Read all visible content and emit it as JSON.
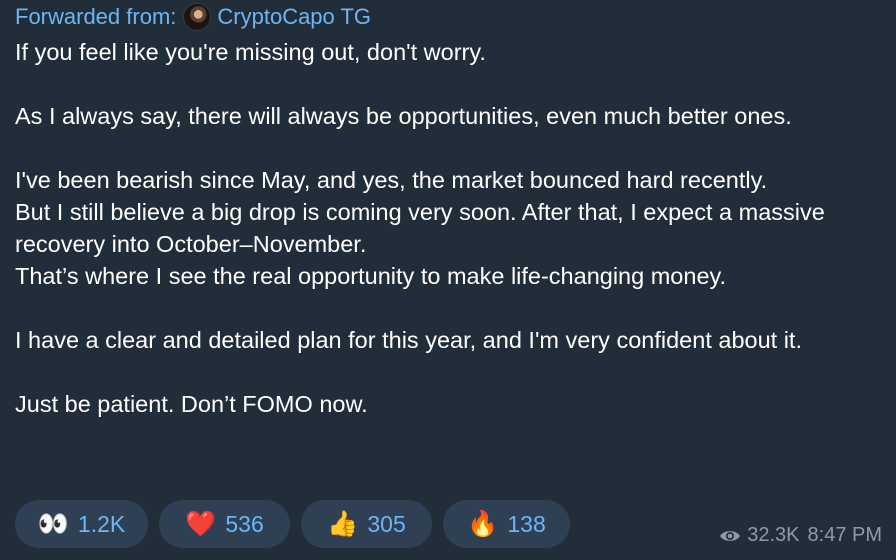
{
  "forward": {
    "prefix": "Forwarded from:",
    "channel": "CryptoCapo TG",
    "avatar_icon": "channel-avatar"
  },
  "message": {
    "paragraphs": [
      "If you feel like you're missing out, don't worry.",
      "As I always say, there will always be opportunities, even much better ones.",
      "I've been bearish since May, and yes, the market bounced hard recently.",
      "But I still believe a big drop is coming very soon. After that, I expect a massive recovery into October–November.",
      "That’s where I see the real opportunity to make life-changing money.",
      "I have a clear and detailed plan for this year, and I'm very confident about it.",
      "Just be patient. Don’t FOMO now."
    ]
  },
  "reactions": [
    {
      "emoji": "👀",
      "icon": "eyes-emoji",
      "count": "1.2K"
    },
    {
      "emoji": "❤️",
      "icon": "heart-emoji",
      "count": "536"
    },
    {
      "emoji": "👍",
      "icon": "thumbs-up-emoji",
      "count": "305"
    },
    {
      "emoji": "🔥",
      "icon": "fire-emoji",
      "count": "138"
    }
  ],
  "meta": {
    "views": "32.3K",
    "time": "8:47 PM",
    "views_icon": "eye-icon"
  },
  "colors": {
    "background": "#222d3a",
    "link": "#6cb6f5",
    "reaction_bg": "#2f4054",
    "meta_text": "#8d9aa8"
  }
}
